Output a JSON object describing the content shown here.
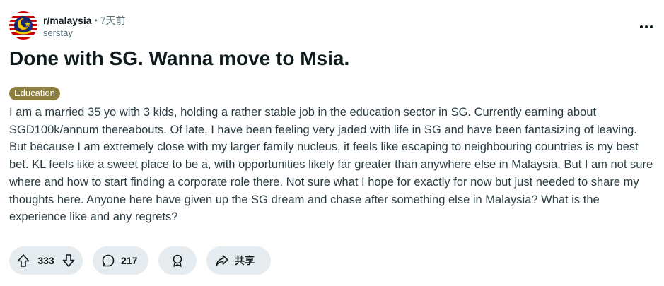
{
  "header": {
    "subreddit": "r/malaysia",
    "separator": "•",
    "time": "7天前",
    "author": "serstay"
  },
  "post": {
    "title": "Done with SG. Wanna move to Msia.",
    "flair": "Education",
    "body": "I am a married 35 yo with 3 kids, holding a rather stable job in the education sector in SG. Currently earning about SGD100k/annum thereabouts. Of late, I have been feeling very jaded with life in SG and have been fantasizing of leaving. But because I am extremely close with my larger family nucleus, it feels like escaping to neighbouring countries is my best bet. KL feels like a sweet place to be a, with opportunities likely far greater than anywhere else in Malaysia. But I am not sure where and how to start finding a corporate role there. Not sure what I hope for exactly for now but just needed to share my thoughts here. Anyone here have given up the SG dream and chase after something else in Malaysia? What is the experience like and any regrets?"
  },
  "actions": {
    "votes": "333",
    "comments": "217",
    "share_label": "共享"
  },
  "colors": {
    "flair_bg": "#8c7e3f",
    "pill_bg": "#e5ebee",
    "text": "#0f1a1c",
    "muted": "#576f76"
  },
  "icons": {
    "avatar": "malaysia-flag-avatar",
    "more": "more-options-icon",
    "upvote": "upvote-arrow-icon",
    "downvote": "downvote-arrow-icon",
    "comment": "comment-bubble-icon",
    "award": "award-icon",
    "share": "share-arrow-icon"
  }
}
